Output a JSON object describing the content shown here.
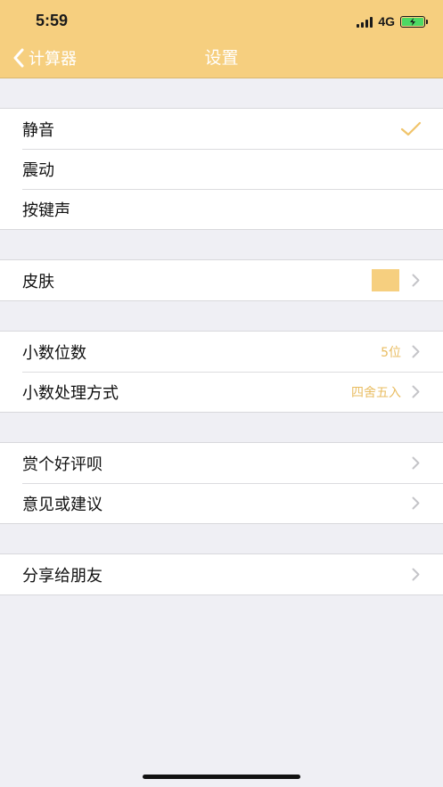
{
  "status_bar": {
    "time": "5:59",
    "network": "4G",
    "signal_bars": 4,
    "battery_charging": true
  },
  "nav": {
    "back_label": "计算器",
    "title": "设置",
    "back_icon": "chevron-left-icon"
  },
  "colors": {
    "accent": "#f6cf7f",
    "value_text": "#e9bd62",
    "background": "#efeff4"
  },
  "sections": {
    "sound": {
      "mute": "静音",
      "vibrate": "震动",
      "key_sound": "按键声",
      "selected": "静音"
    },
    "skin": {
      "label": "皮肤",
      "color": "#f6cf7f"
    },
    "decimal": {
      "places_label": "小数位数",
      "places_value": "5位",
      "rounding_label": "小数处理方式",
      "rounding_value": "四舍五入"
    },
    "feedback": {
      "rate_label": "赏个好评呗",
      "suggest_label": "意见或建议"
    },
    "share": {
      "label": "分享给朋友"
    }
  }
}
